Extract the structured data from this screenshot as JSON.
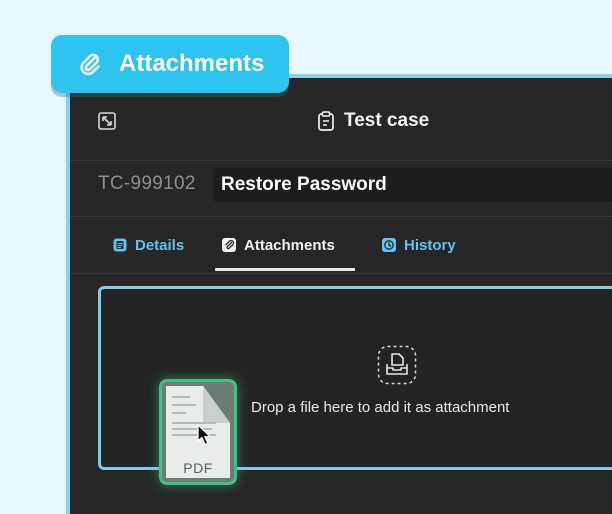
{
  "chip": {
    "label": "Attachments",
    "icon": "paperclip-icon"
  },
  "header": {
    "title": "Test case",
    "title_icon": "clipboard-icon",
    "expand_icon": "expand-icon"
  },
  "case": {
    "id": "TC-999102",
    "name": "Restore Password"
  },
  "tabs": [
    {
      "label": "Details",
      "icon": "details-icon",
      "active": false
    },
    {
      "label": "Attachments",
      "icon": "paperclip-icon",
      "active": true
    },
    {
      "label": "History",
      "icon": "history-icon",
      "active": false
    }
  ],
  "dropzone": {
    "text": "Drop a file here to add it as attachment",
    "icon": "file-upload-icon"
  },
  "dragged_file": {
    "type_label": "PDF"
  },
  "colors": {
    "accent": "#2fc4ef",
    "panel": "#262626",
    "tab_link": "#5fc4ef",
    "drop_border": "#7ecbea",
    "pdf_glow": "#3ec089"
  }
}
